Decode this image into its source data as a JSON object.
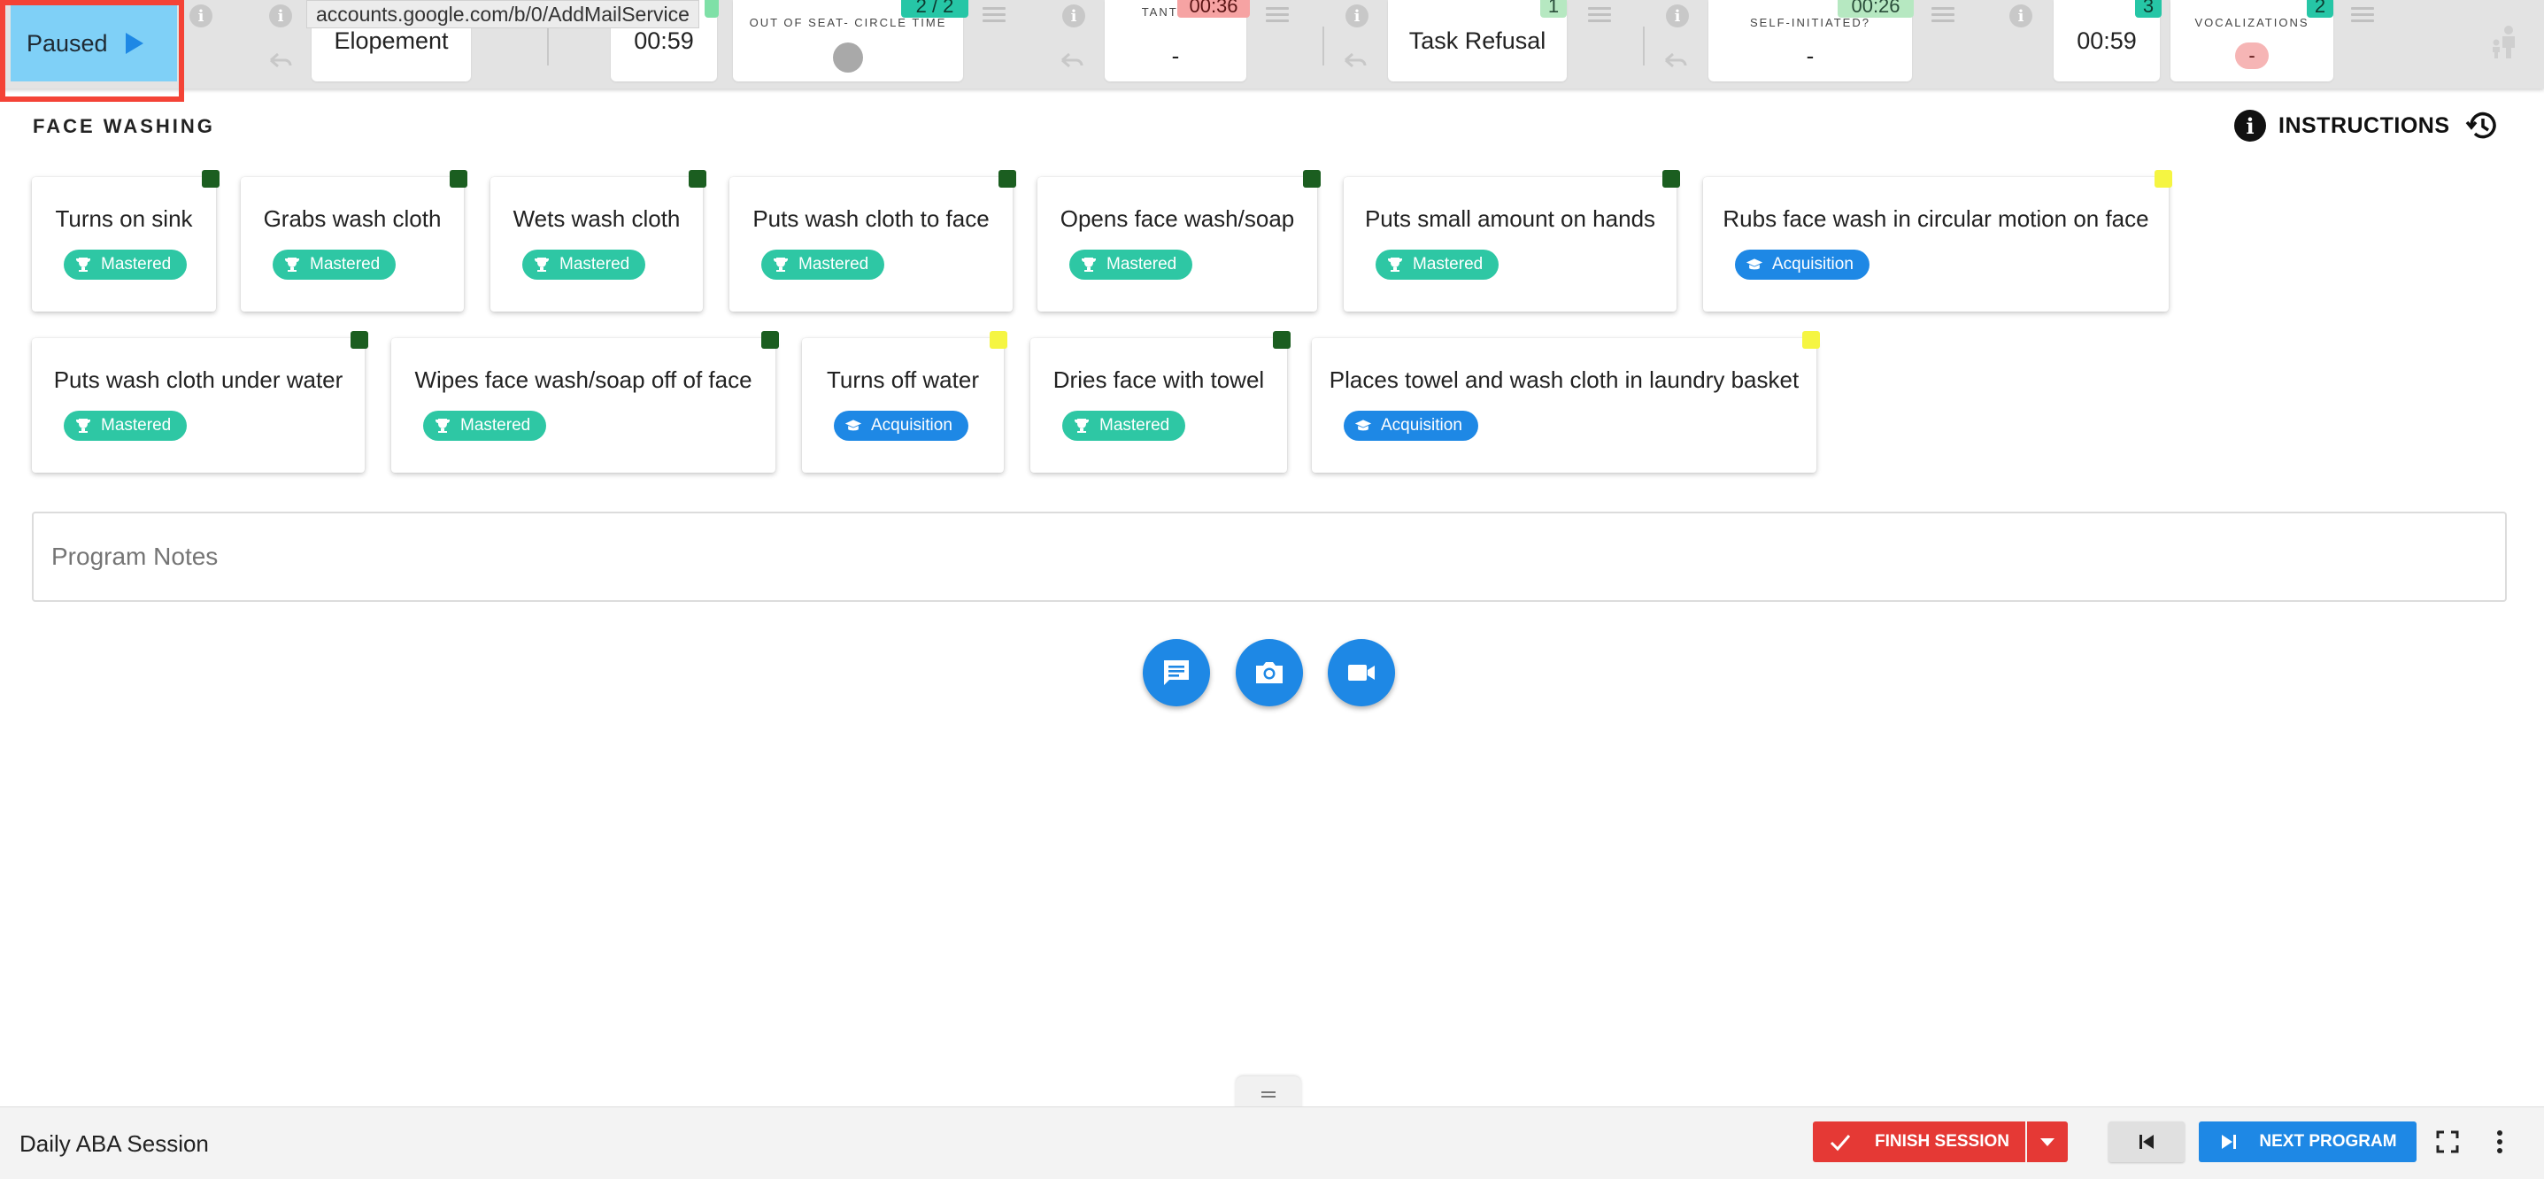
{
  "toolbar": {
    "paused_label": "Paused",
    "url_tooltip": "accounts.google.com/b/0/AddMailService",
    "elopement": {
      "label": "Elopement"
    },
    "timer1": {
      "time": "00:59"
    },
    "out_of_seat": {
      "label": "OUT OF SEAT- CIRCLE TIME",
      "badge": "2 / 2"
    },
    "tantrum": {
      "label": "TANTRUM",
      "value": "-",
      "badge": "00:36"
    },
    "task_refusal": {
      "label": "Task Refusal",
      "badge": "1"
    },
    "self_initiated": {
      "label": "SELF-INITIATED?",
      "value": "-",
      "badge": "00:26"
    },
    "timer2": {
      "time": "00:59",
      "badge": "3"
    },
    "vocalizations": {
      "label": "VOCALIZATIONS",
      "value": "-",
      "badge": "2"
    }
  },
  "program": {
    "title": "FACE WASHING",
    "instructions_label": "INSTRUCTIONS"
  },
  "steps": [
    {
      "title": "Turns on sink",
      "status": "Mastered",
      "flag": "dark-green"
    },
    {
      "title": "Grabs wash cloth",
      "status": "Mastered",
      "flag": "dark-green"
    },
    {
      "title": "Wets wash cloth",
      "status": "Mastered",
      "flag": "dark-green"
    },
    {
      "title": "Puts wash cloth to face",
      "status": "Mastered",
      "flag": "dark-green"
    },
    {
      "title": "Opens face wash/soap",
      "status": "Mastered",
      "flag": "dark-green"
    },
    {
      "title": "Puts small amount on hands",
      "status": "Mastered",
      "flag": "dark-green"
    },
    {
      "title": "Rubs face wash in circular motion on face",
      "status": "Acquisition",
      "flag": "yellow"
    },
    {
      "title": "Puts wash cloth under water",
      "status": "Mastered",
      "flag": "dark-green"
    },
    {
      "title": "Wipes face wash/soap off of face",
      "status": "Mastered",
      "flag": "dark-green"
    },
    {
      "title": "Turns off water",
      "status": "Acquisition",
      "flag": "yellow"
    },
    {
      "title": "Dries face with towel",
      "status": "Mastered",
      "flag": "dark-green"
    },
    {
      "title": "Places towel and wash cloth in laundry basket",
      "status": "Acquisition",
      "flag": "yellow"
    }
  ],
  "notes": {
    "placeholder": "Program Notes",
    "value": ""
  },
  "actions": {
    "comment_icon": "comment-icon",
    "camera_icon": "camera-icon",
    "video_icon": "video-icon"
  },
  "bottombar": {
    "session_name": "Daily ABA Session",
    "finish_label": "FINISH SESSION",
    "next_label": "NEXT PROGRAM"
  },
  "colors": {
    "accent_blue": "#1e88e5",
    "mastered_teal": "#2ec7a4",
    "finish_red": "#e53935",
    "paused_bg": "#7fd0f7"
  }
}
